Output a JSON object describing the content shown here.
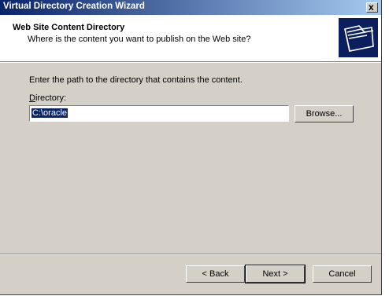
{
  "window": {
    "title": "Virtual Directory Creation Wizard",
    "close_glyph": "x"
  },
  "header": {
    "title": "Web Site Content Directory",
    "subtitle": "Where is the content you want to publish on the Web site?",
    "icon": "folders-icon"
  },
  "body": {
    "instruction": "Enter the path to the directory that contains the content.",
    "directory_label": "Directory:",
    "directory_value": "C:\\oracle"
  },
  "buttons": {
    "browse": "Browse...",
    "back": "< Back",
    "next": "Next >",
    "cancel": "Cancel"
  }
}
